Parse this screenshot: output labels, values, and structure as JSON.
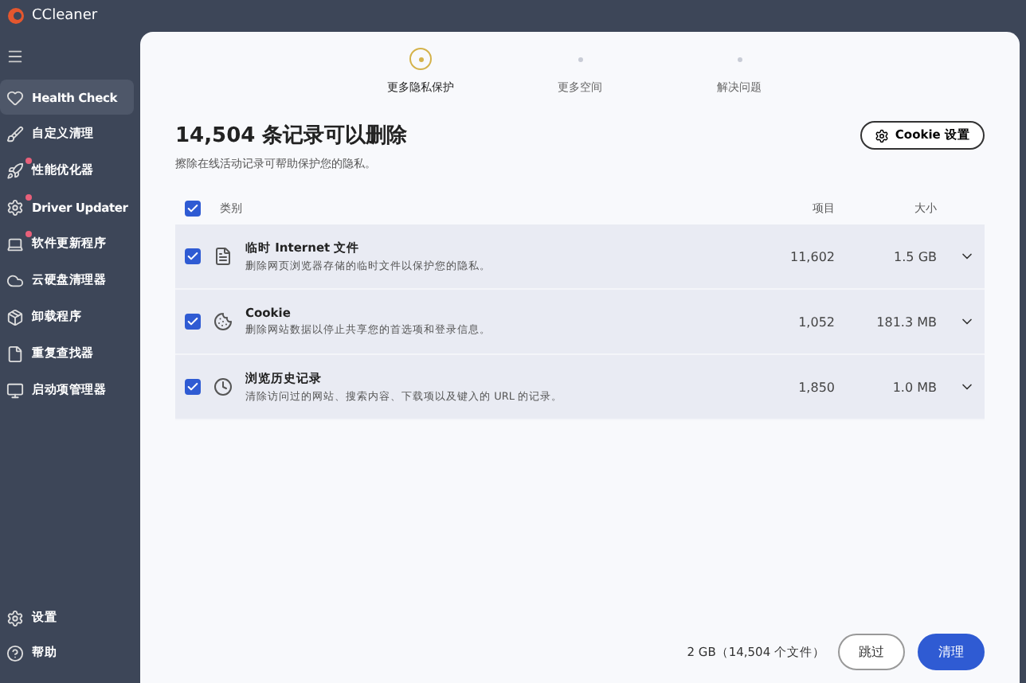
{
  "app": {
    "title": "CCleaner"
  },
  "sidebar": {
    "items": [
      {
        "label": "Health Check",
        "selected": true,
        "badge": false
      },
      {
        "label": "自定义清理",
        "selected": false,
        "badge": false
      },
      {
        "label": "性能优化器",
        "selected": false,
        "badge": true
      },
      {
        "label": "Driver Updater",
        "selected": false,
        "badge": true
      },
      {
        "label": "软件更新程序",
        "selected": false,
        "badge": true
      },
      {
        "label": "云硬盘清理器",
        "selected": false,
        "badge": false
      },
      {
        "label": "卸载程序",
        "selected": false,
        "badge": false
      },
      {
        "label": "重复查找器",
        "selected": false,
        "badge": false
      },
      {
        "label": "启动项管理器",
        "selected": false,
        "badge": false
      }
    ],
    "footer": [
      {
        "label": "设置"
      },
      {
        "label": "帮助"
      }
    ]
  },
  "steps": [
    {
      "label": "更多隐私保护",
      "selected": true
    },
    {
      "label": "更多空间",
      "selected": false
    },
    {
      "label": "解决问题",
      "selected": false
    }
  ],
  "heading": "14,504 条记录可以删除",
  "subheading": "擦除在线活动记录可帮助保护您的隐私。",
  "cookie_button": "Cookie 设置",
  "table": {
    "select_all_checked": true,
    "columns": [
      "类别",
      "项目",
      "大小"
    ],
    "rows": [
      {
        "title": "临时 Internet 文件",
        "description": "删除网页浏览器存储的临时文件以保护您的隐私。",
        "items": "11,602",
        "size": "1.5 GB",
        "checked": true
      },
      {
        "title": "Cookie",
        "description": "删除网站数据以停止共享您的首选项和登录信息。",
        "items": "1,052",
        "size": "181.3 MB",
        "checked": true
      },
      {
        "title": "浏览历史记录",
        "description": "清除访问过的网站、搜索内容、下载项以及键入的 URL 的记录。",
        "items": "1,850",
        "size": "1.0 MB",
        "checked": true
      }
    ]
  },
  "summary": "2 GB（14,504 个文件）",
  "buttons": {
    "skip": "跳过",
    "clean": "清理"
  }
}
